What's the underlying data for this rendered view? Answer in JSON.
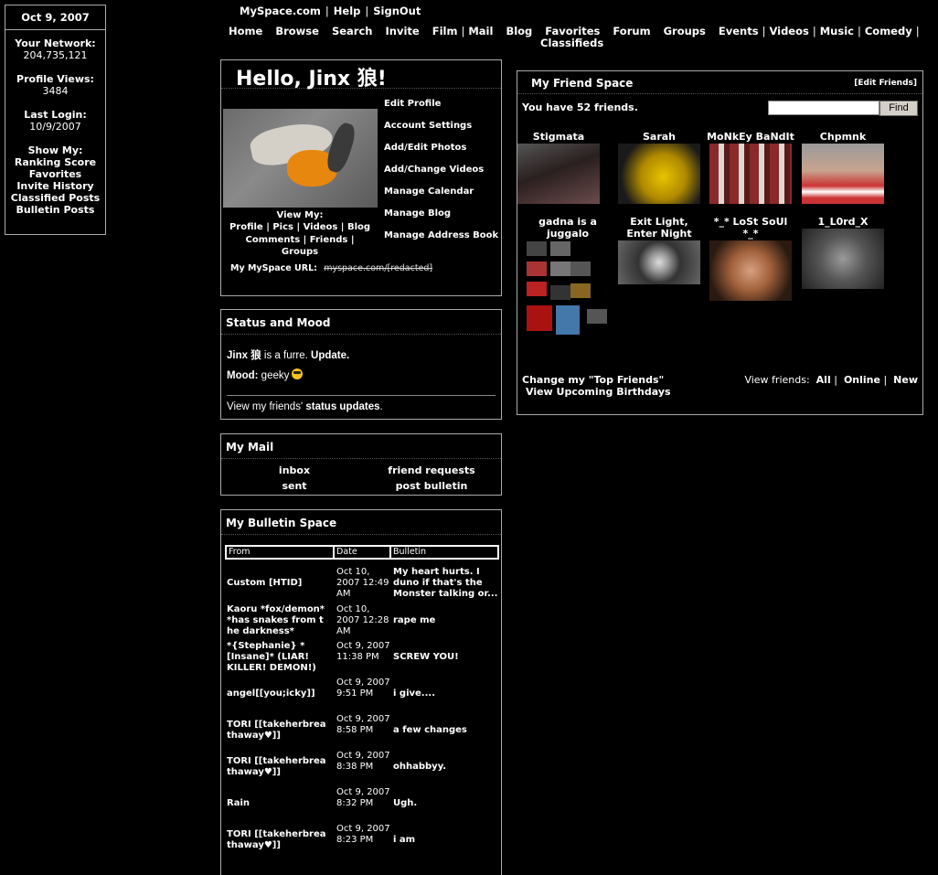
{
  "sidebar": {
    "date": "Oct 9, 2007",
    "network_label": "Your Network:",
    "network_value": "204,735,121",
    "views_label": "Profile Views:",
    "views_value": "3484",
    "login_label": "Last Login:",
    "login_value": "10/9/2007",
    "show_label": "Show My:",
    "show_items": [
      "Ranking Score",
      "Favorites",
      "Invite History",
      "Classified Posts",
      "Bulletin Posts"
    ]
  },
  "toplinks": [
    "MySpace.com",
    "Help",
    "SignOut"
  ],
  "nav": {
    "home": "Home",
    "browse": "Browse",
    "search": "Search",
    "invite": "Invite",
    "film": "Film",
    "mail": "Mail",
    "blog": "Blog",
    "favorites": "Favorites",
    "forum": "Forum",
    "groups": "Groups",
    "events": "Events",
    "videos": "Videos",
    "music": "Music",
    "comedy": "Comedy",
    "classifieds": "Classifieds"
  },
  "hello": {
    "title": "Hello, Jinx 狼!",
    "links": [
      "Edit Profile",
      "Account Settings",
      "Add/Edit Photos",
      "Add/Change Videos",
      "Manage Calendar",
      "Manage Blog",
      "Manage Address Book"
    ],
    "view_my": "View My:",
    "view_row1": "Profile | Pics | Videos | Blog",
    "view_row2": "Comments | Friends | Groups",
    "url_label": "My MySpace URL:",
    "url_value": "myspace.com/[redacted]"
  },
  "status": {
    "title": "Status and Mood",
    "name": "Jinx 狼",
    "status_text": " is a furre. ",
    "update": "Update.",
    "mood_label": "Mood:",
    "mood_value": " geeky",
    "friends_prefix": "View my friends' ",
    "friends_link": "status updates",
    "friends_suffix": "."
  },
  "mail": {
    "title": "My Mail",
    "inbox": "inbox",
    "friend_requests": "friend requests",
    "sent": "sent",
    "post_bulletin": "post bulletin"
  },
  "bulletin": {
    "title": "My Bulletin Space",
    "columns": [
      "From",
      "Date",
      "Bulletin"
    ],
    "rows": [
      {
        "from": "Custom [HTID]",
        "date": "Oct 10, 2007 12:49 AM",
        "msg": "My heart hurts. I duno if that's the Monster talking or..."
      },
      {
        "from": "Kaoru *fox/demon* *has snakes from the darkness*",
        "date": "Oct 10, 2007 12:28 AM",
        "msg": "rape me"
      },
      {
        "from": "*{Stephanie} *[Insane]* (LIAR! KILLER! DEMON!)",
        "date": "Oct 9, 2007 11:38 PM",
        "msg": "SCREW YOU!"
      },
      {
        "from": "angel[[you;icky]]",
        "date": "Oct 9, 2007 9:51 PM",
        "msg": "i give...."
      },
      {
        "from": "TORI [[takeherbreathaway♥]]",
        "date": "Oct 9, 2007 8:58 PM",
        "msg": "a few changes"
      },
      {
        "from": "TORI [[takeherbreathaway♥]]",
        "date": "Oct 9, 2007 8:38 PM",
        "msg": "ohhabbyy."
      },
      {
        "from": "Rain",
        "date": "Oct 9, 2007 8:32 PM",
        "msg": "Ugh."
      },
      {
        "from": "TORI [[takeherbreathaway♥]]",
        "date": "Oct 9, 2007 8:23 PM",
        "msg": "i am"
      }
    ]
  },
  "friends": {
    "title": "My Friend Space",
    "edit": "[Edit Friends]",
    "count_text": "You have 52 friends.",
    "find_button": "Find",
    "search_placeholder": "",
    "list": [
      {
        "name": "Stigmata",
        "color": "#3a2a2a"
      },
      {
        "name": "Sarah",
        "color": "#c9b200"
      },
      {
        "name": "MoNkEy BaNdIt",
        "color": "#7a3b3b"
      },
      {
        "name": "Chpmnk",
        "color": "#b08070"
      },
      {
        "name": "gadna is a juggalo",
        "color": "#333333"
      },
      {
        "name": "Exit Light, Enter Night",
        "color": "#555555"
      },
      {
        "name": "*_* LoSt SoUl *_*",
        "color": "#8a5030"
      },
      {
        "name": "1_L0rd_X",
        "color": "#4a4a4a"
      }
    ],
    "change_top": "Change my \"Top Friends\"",
    "birthdays": "View Upcoming Birthdays",
    "view_label": "View friends:",
    "view_all": "All",
    "view_online": "Online",
    "view_new": "New"
  }
}
